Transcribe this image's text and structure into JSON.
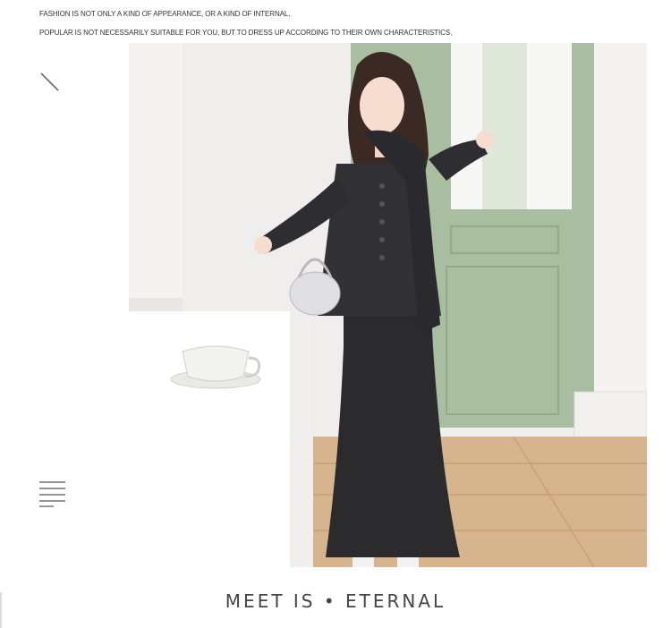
{
  "header": {
    "line1": "FASHION IS NOT ONLY A KIND OF APPEARANCE, OR A KIND OF INTERNAL,",
    "line2": "POPULAR IS NOT NECESSARILY SUITABLE FOR YOU, BUT TO DRESS UP ACCORDING TO THEIR OWN CHARACTERISTICS,"
  },
  "icons": {
    "slash": "diagonal-line-icon",
    "menu": "menu-lines-icon"
  },
  "photo": {
    "subject": "model-in-dark-knit-cardigan-and-maxi-skirt"
  },
  "footer": {
    "brand_text": "MEET IS • ETERNAL"
  },
  "colors": {
    "text_dark": "#333333",
    "footer_text": "#444444",
    "door_green": "#a9bea0",
    "outfit_black": "#2b2b2e",
    "floor_wood": "#d6b48e"
  }
}
